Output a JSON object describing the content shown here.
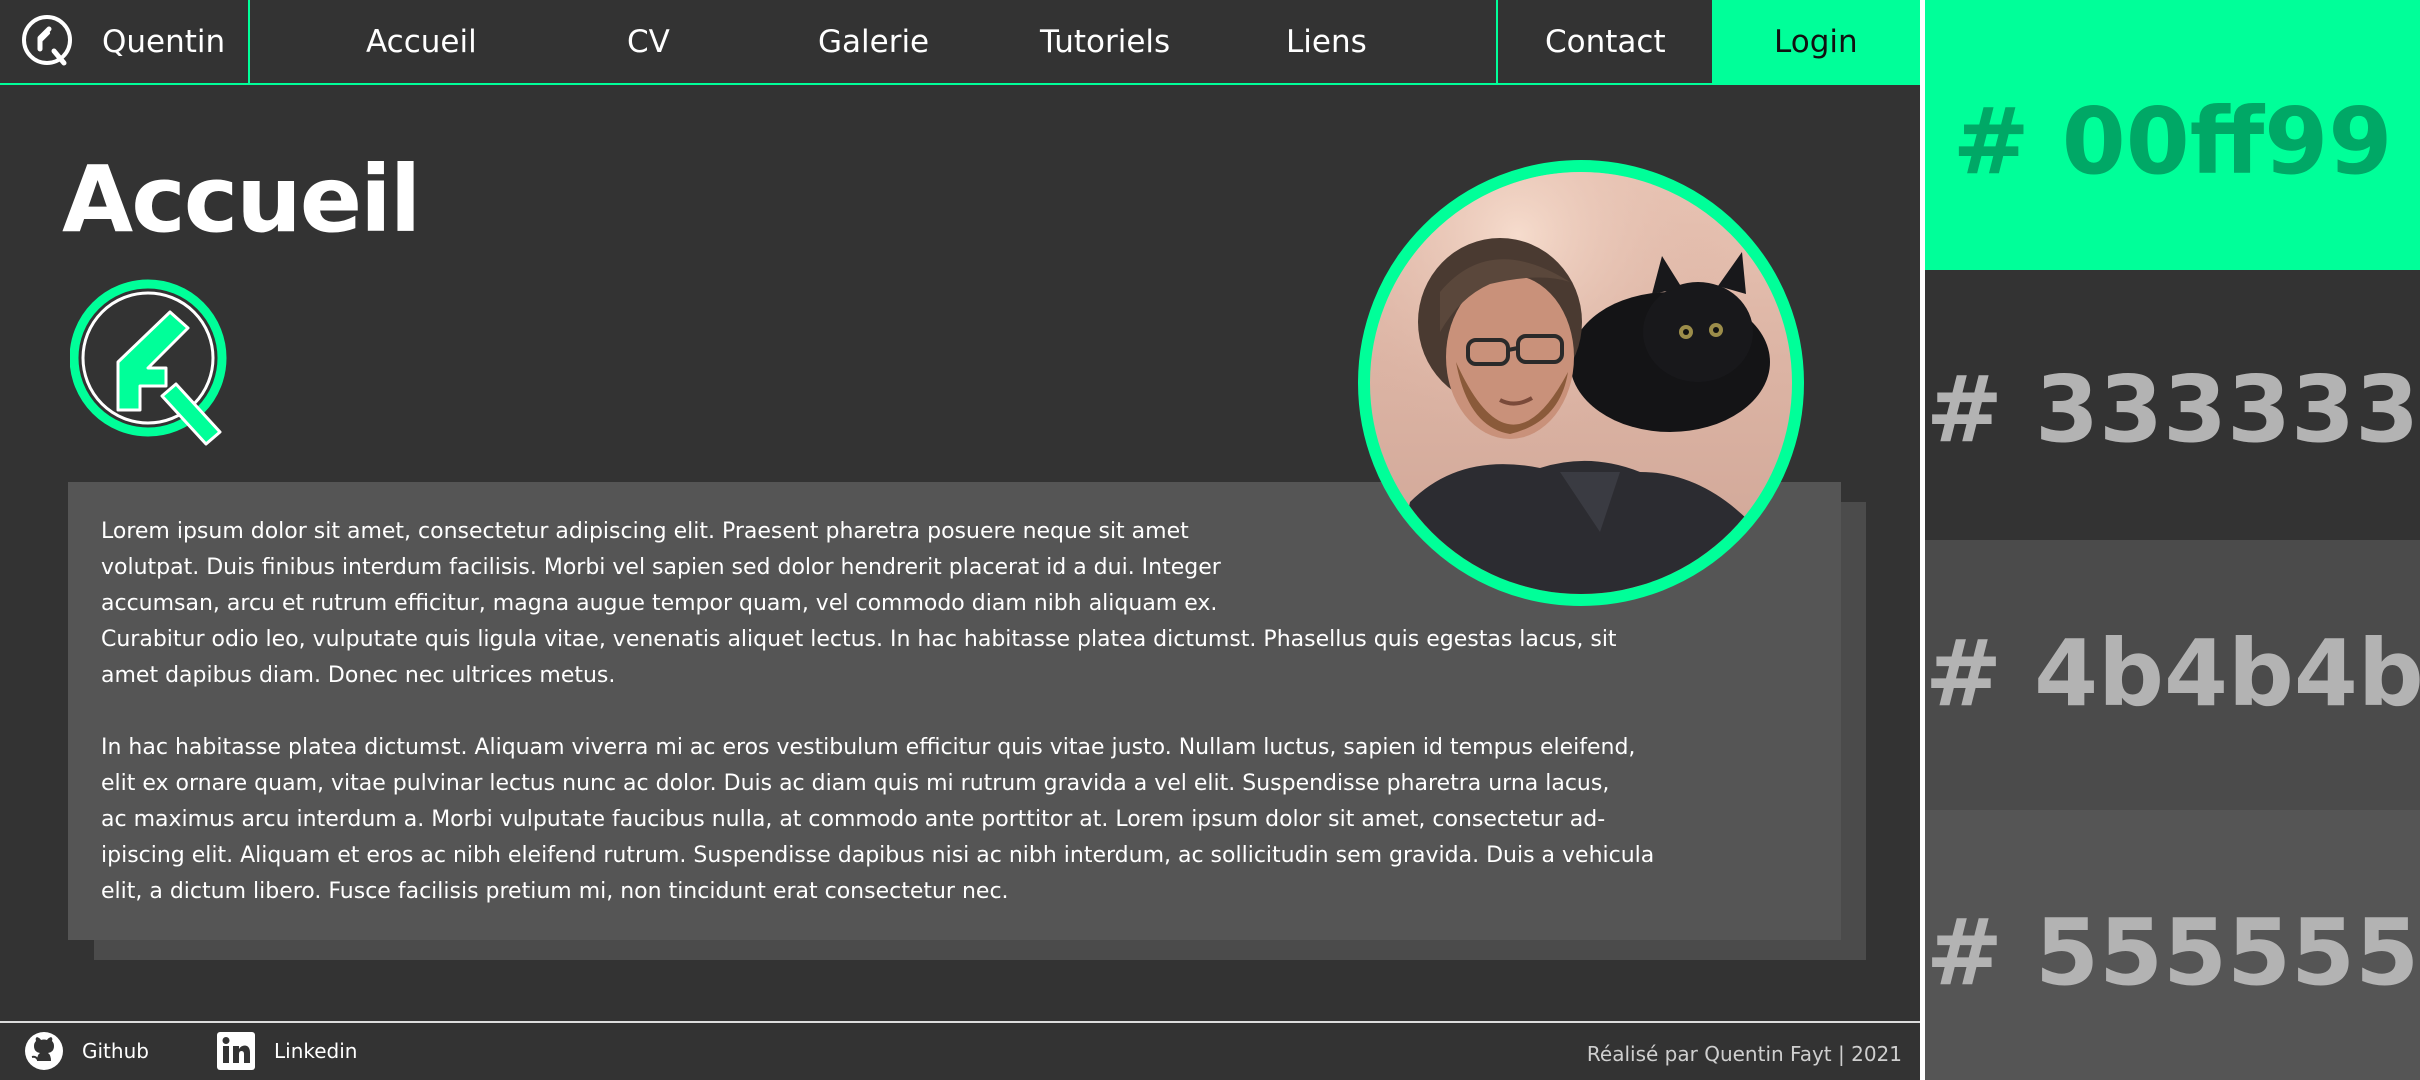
{
  "nav": {
    "brand_name": "Quentin",
    "links": [
      "Accueil",
      "CV",
      "Galerie",
      "Tutoriels",
      "Liens"
    ],
    "contact": "Contact",
    "login": "Login"
  },
  "main": {
    "title": "Accueil",
    "paragraphs": [
      "Lorem ipsum dolor sit amet, consectetur adipiscing elit. Praesent pharetra posuere neque sit amet\nvolutpat. Duis finibus interdum facilisis. Morbi vel sapien sed dolor hendrerit placerat id a dui. Integer\n accumsan, arcu et rutrum efficitur, magna augue tempor quam, vel commodo diam nibh aliquam ex.\nCurabitur odio leo, vulputate quis ligula vitae, venenatis aliquet lectus. In hac habitasse platea dictumst. Phasellus quis egestas lacus, sit\namet dapibus diam. Donec nec ultrices metus.",
      "In hac habitasse platea dictumst. Aliquam viverra mi ac eros vestibulum efficitur quis vitae justo. Nullam luctus, sapien id tempus eleifend,\nelit ex ornare quam, vitae pulvinar lectus nunc ac dolor. Duis ac diam quis mi rutrum gravida a vel elit. Suspendisse pharetra urna lacus,\nac maximus arcu interdum a. Morbi vulputate faucibus nulla, at commodo ante porttitor at. Lorem ipsum dolor sit amet, consectetur ad-\nipiscing elit. Aliquam et eros ac nibh eleifend rutrum. Suspendisse dapibus nisi ac nibh interdum, ac sollicitudin sem gravida. Duis a vehicula\nelit, a dictum libero. Fusce facilisis pretium mi, non tincidunt erat consectetur nec."
    ]
  },
  "footer": {
    "github": "Github",
    "linkedin": "Linkedin",
    "credits": "Réalisé par Quentin Fayt | 2021"
  },
  "swatches": [
    {
      "label": "# 00ff99",
      "color": "#00ff99",
      "text_color": "#00a866"
    },
    {
      "label": "# 333333",
      "color": "#333333",
      "text_color": "#b3b3b3"
    },
    {
      "label": "# 4b4b4b",
      "color": "#4b4b4b",
      "text_color": "#b3b3b3"
    },
    {
      "label": "# 555555",
      "color": "#555555",
      "text_color": "#b3b3b3"
    }
  ],
  "icons": [
    "qf-logo-icon",
    "github-icon",
    "linkedin-icon"
  ]
}
